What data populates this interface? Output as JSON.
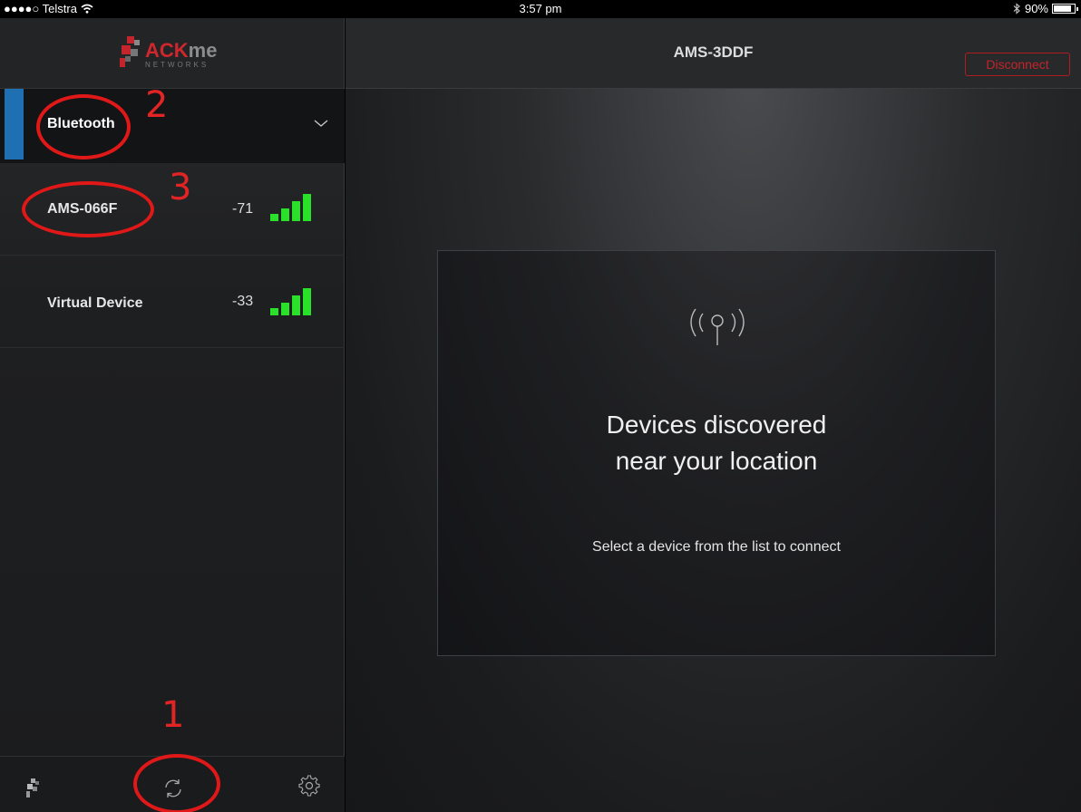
{
  "status_bar": {
    "carrier": "●●●●○ Telstra",
    "time": "3:57 pm",
    "battery": "90%"
  },
  "sidebar": {
    "logo": {
      "ack": "ACK",
      "me": "me",
      "sub": "NETWORKS"
    },
    "section": {
      "label": "Bluetooth"
    },
    "devices": [
      {
        "name": "AMS-066F",
        "rssi": "-71"
      },
      {
        "name": "Virtual Device",
        "rssi": "-33"
      }
    ]
  },
  "main": {
    "title": "AMS-3DDF",
    "disconnect_label": "Disconnect",
    "card": {
      "headline_line1": "Devices discovered",
      "headline_line2": "near your location",
      "subtitle": "Select a device from the list to connect"
    }
  },
  "annotations": {
    "one": "1",
    "two": "2",
    "three": "3"
  },
  "colors": {
    "accent_blue": "#1f6fb3",
    "signal_green": "#2ae12a",
    "brand_red": "#c4242b",
    "annotation_red": "#e32424"
  },
  "icons": {
    "wifi": "wifi-icon",
    "bluetooth": "bluetooth-icon",
    "chevron": "chevron-down-icon",
    "antenna": "antenna-icon",
    "refresh": "refresh-icon",
    "settings": "gear-icon",
    "home": "ackme-logo-icon"
  }
}
